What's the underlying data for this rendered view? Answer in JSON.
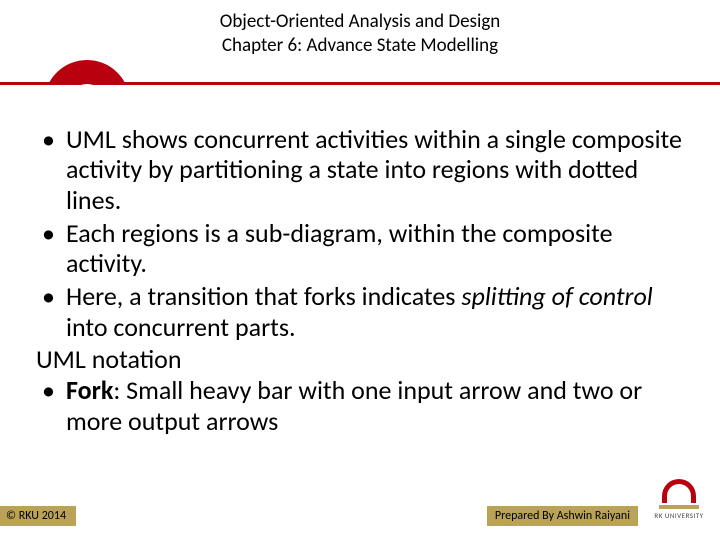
{
  "header": {
    "line1": "Object-Oriented Analysis and Design",
    "line2": "Chapter 6: Advance State Modelling"
  },
  "bullets": {
    "b1": "UML shows concurrent activities within a single composite activity by partitioning a state into regions with dotted lines.",
    "b2": "Each regions is a sub-diagram, within the composite activity.",
    "b3_pre": "Here, a transition that forks indicates ",
    "b3_em": "splitting of control",
    "b3_post": " into concurrent parts.",
    "subhead": "UML notation",
    "b4_bold": "Fork",
    "b4_post": ": Small heavy bar with one input arrow and two or more output arrows"
  },
  "footer": {
    "copyright": "© RKU 2014",
    "author": "Prepared By Ashwin Raiyani",
    "logo_text": "RK UNIVERSITY"
  }
}
